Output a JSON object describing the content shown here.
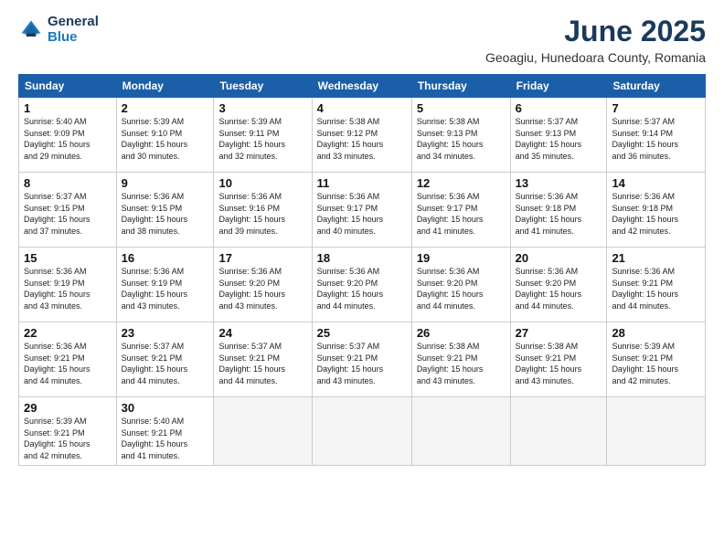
{
  "logo": {
    "line1": "General",
    "line2": "Blue"
  },
  "title": "June 2025",
  "location": "Geoagiu, Hunedoara County, Romania",
  "headers": [
    "Sunday",
    "Monday",
    "Tuesday",
    "Wednesday",
    "Thursday",
    "Friday",
    "Saturday"
  ],
  "weeks": [
    [
      {
        "day": "1",
        "info": "Sunrise: 5:40 AM\nSunset: 9:09 PM\nDaylight: 15 hours\nand 29 minutes."
      },
      {
        "day": "2",
        "info": "Sunrise: 5:39 AM\nSunset: 9:10 PM\nDaylight: 15 hours\nand 30 minutes."
      },
      {
        "day": "3",
        "info": "Sunrise: 5:39 AM\nSunset: 9:11 PM\nDaylight: 15 hours\nand 32 minutes."
      },
      {
        "day": "4",
        "info": "Sunrise: 5:38 AM\nSunset: 9:12 PM\nDaylight: 15 hours\nand 33 minutes."
      },
      {
        "day": "5",
        "info": "Sunrise: 5:38 AM\nSunset: 9:13 PM\nDaylight: 15 hours\nand 34 minutes."
      },
      {
        "day": "6",
        "info": "Sunrise: 5:37 AM\nSunset: 9:13 PM\nDaylight: 15 hours\nand 35 minutes."
      },
      {
        "day": "7",
        "info": "Sunrise: 5:37 AM\nSunset: 9:14 PM\nDaylight: 15 hours\nand 36 minutes."
      }
    ],
    [
      {
        "day": "8",
        "info": "Sunrise: 5:37 AM\nSunset: 9:15 PM\nDaylight: 15 hours\nand 37 minutes."
      },
      {
        "day": "9",
        "info": "Sunrise: 5:36 AM\nSunset: 9:15 PM\nDaylight: 15 hours\nand 38 minutes."
      },
      {
        "day": "10",
        "info": "Sunrise: 5:36 AM\nSunset: 9:16 PM\nDaylight: 15 hours\nand 39 minutes."
      },
      {
        "day": "11",
        "info": "Sunrise: 5:36 AM\nSunset: 9:17 PM\nDaylight: 15 hours\nand 40 minutes."
      },
      {
        "day": "12",
        "info": "Sunrise: 5:36 AM\nSunset: 9:17 PM\nDaylight: 15 hours\nand 41 minutes."
      },
      {
        "day": "13",
        "info": "Sunrise: 5:36 AM\nSunset: 9:18 PM\nDaylight: 15 hours\nand 41 minutes."
      },
      {
        "day": "14",
        "info": "Sunrise: 5:36 AM\nSunset: 9:18 PM\nDaylight: 15 hours\nand 42 minutes."
      }
    ],
    [
      {
        "day": "15",
        "info": "Sunrise: 5:36 AM\nSunset: 9:19 PM\nDaylight: 15 hours\nand 43 minutes."
      },
      {
        "day": "16",
        "info": "Sunrise: 5:36 AM\nSunset: 9:19 PM\nDaylight: 15 hours\nand 43 minutes."
      },
      {
        "day": "17",
        "info": "Sunrise: 5:36 AM\nSunset: 9:20 PM\nDaylight: 15 hours\nand 43 minutes."
      },
      {
        "day": "18",
        "info": "Sunrise: 5:36 AM\nSunset: 9:20 PM\nDaylight: 15 hours\nand 44 minutes."
      },
      {
        "day": "19",
        "info": "Sunrise: 5:36 AM\nSunset: 9:20 PM\nDaylight: 15 hours\nand 44 minutes."
      },
      {
        "day": "20",
        "info": "Sunrise: 5:36 AM\nSunset: 9:20 PM\nDaylight: 15 hours\nand 44 minutes."
      },
      {
        "day": "21",
        "info": "Sunrise: 5:36 AM\nSunset: 9:21 PM\nDaylight: 15 hours\nand 44 minutes."
      }
    ],
    [
      {
        "day": "22",
        "info": "Sunrise: 5:36 AM\nSunset: 9:21 PM\nDaylight: 15 hours\nand 44 minutes."
      },
      {
        "day": "23",
        "info": "Sunrise: 5:37 AM\nSunset: 9:21 PM\nDaylight: 15 hours\nand 44 minutes."
      },
      {
        "day": "24",
        "info": "Sunrise: 5:37 AM\nSunset: 9:21 PM\nDaylight: 15 hours\nand 44 minutes."
      },
      {
        "day": "25",
        "info": "Sunrise: 5:37 AM\nSunset: 9:21 PM\nDaylight: 15 hours\nand 43 minutes."
      },
      {
        "day": "26",
        "info": "Sunrise: 5:38 AM\nSunset: 9:21 PM\nDaylight: 15 hours\nand 43 minutes."
      },
      {
        "day": "27",
        "info": "Sunrise: 5:38 AM\nSunset: 9:21 PM\nDaylight: 15 hours\nand 43 minutes."
      },
      {
        "day": "28",
        "info": "Sunrise: 5:39 AM\nSunset: 9:21 PM\nDaylight: 15 hours\nand 42 minutes."
      }
    ],
    [
      {
        "day": "29",
        "info": "Sunrise: 5:39 AM\nSunset: 9:21 PM\nDaylight: 15 hours\nand 42 minutes."
      },
      {
        "day": "30",
        "info": "Sunrise: 5:40 AM\nSunset: 9:21 PM\nDaylight: 15 hours\nand 41 minutes."
      },
      {
        "day": "",
        "info": ""
      },
      {
        "day": "",
        "info": ""
      },
      {
        "day": "",
        "info": ""
      },
      {
        "day": "",
        "info": ""
      },
      {
        "day": "",
        "info": ""
      }
    ]
  ]
}
